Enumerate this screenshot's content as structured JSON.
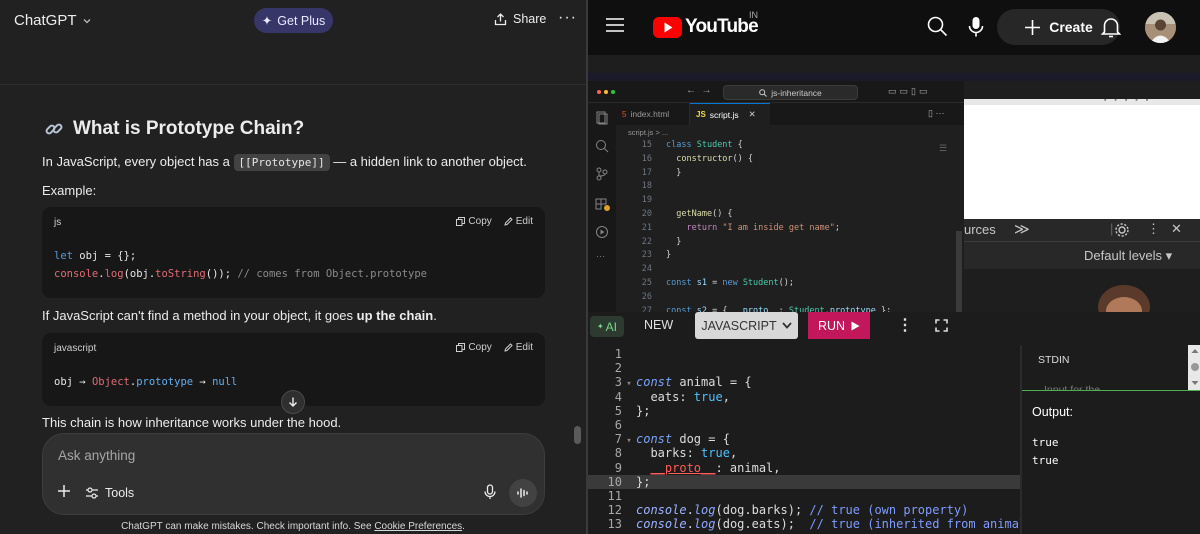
{
  "chatgpt": {
    "title": "ChatGPT",
    "get_plus": "Get Plus",
    "share": "Share",
    "more": "···",
    "heading_icon": "link-emoji",
    "heading": "What is Prototype Chain?",
    "p1_before": "In JavaScript, every object has a",
    "p1_code": "[[Prototype]]",
    "p1_after": "— a hidden link to another object.",
    "example": "Example:",
    "code1": {
      "lang": "js",
      "copy": "Copy",
      "edit": "Edit",
      "line1_kw": "let",
      "line1_rest": " obj = {};",
      "line2_obj": "console",
      "line2_dot": ".",
      "line2_fn": "log",
      "line2_mid": "(obj.",
      "line2_fn2": "toString",
      "line2_end": "()); ",
      "line2_comment": "// comes from Object.prototype"
    },
    "p2_before": "If JavaScript can't find a method in your object, it goes",
    "p2_bold": "up the chain",
    "p2_after": ".",
    "code2": {
      "lang": "javascript",
      "copy": "Copy",
      "edit": "Edit",
      "t1": "obj → ",
      "t2": "Object",
      "t3": ".",
      "t4": "prototype",
      "t5": " → ",
      "t6": "null"
    },
    "p3": "This chain is how inheritance works under the hood.",
    "composer_placeholder": "Ask anything",
    "tools": "Tools",
    "disclaimer": "ChatGPT can make mistakes. Check important info. See",
    "cookie_link": "Cookie Preferences",
    "disclaimer_end": "."
  },
  "youtube": {
    "logo": "YouTube",
    "country": "IN",
    "create": "Create",
    "video": {
      "search_text": "js-inheritance",
      "tab1": "index.html",
      "tab2": "script.js",
      "breadcrumb": "script.js > ...",
      "code": [
        {
          "n": "15",
          "t": [
            [
              "c-blue",
              "class"
            ],
            [
              "",
              " "
            ],
            [
              "c-cls",
              "Student"
            ],
            [
              "",
              " {"
            ]
          ]
        },
        {
          "n": "16",
          "t": [
            [
              "",
              "  "
            ],
            [
              "c-fn",
              "constructor"
            ],
            [
              "",
              "() {"
            ]
          ]
        },
        {
          "n": "17",
          "t": [
            [
              "",
              "  }"
            ]
          ]
        },
        {
          "n": "18",
          "t": [
            [
              "",
              ""
            ]
          ]
        },
        {
          "n": "19",
          "t": [
            [
              "",
              ""
            ]
          ]
        },
        {
          "n": "20",
          "t": [
            [
              "",
              "  "
            ],
            [
              "c-fn",
              "getName"
            ],
            [
              "",
              "() {"
            ]
          ]
        },
        {
          "n": "21",
          "t": [
            [
              "",
              "    "
            ],
            [
              "c-kw",
              "return"
            ],
            [
              "",
              " "
            ],
            [
              "c-str",
              "\"I am inside get name\""
            ],
            [
              "",
              ";"
            ]
          ]
        },
        {
          "n": "22",
          "t": [
            [
              "",
              "  }"
            ]
          ]
        },
        {
          "n": "23",
          "t": [
            [
              "",
              "}"
            ]
          ]
        },
        {
          "n": "24",
          "t": [
            [
              "",
              ""
            ]
          ]
        },
        {
          "n": "25",
          "t": [
            [
              "c-blue",
              "const"
            ],
            [
              "",
              " "
            ],
            [
              "c-var",
              "s1"
            ],
            [
              "",
              " = "
            ],
            [
              "c-blue",
              "new"
            ],
            [
              "",
              " "
            ],
            [
              "c-cls",
              "Student"
            ],
            [
              "",
              "();"
            ]
          ]
        },
        {
          "n": "26",
          "t": [
            [
              "",
              ""
            ]
          ]
        },
        {
          "n": "27",
          "t": [
            [
              "c-blue",
              "const"
            ],
            [
              "",
              " "
            ],
            [
              "c-var",
              "s2"
            ],
            [
              "",
              " = { "
            ],
            [
              "c-var",
              "__proto__"
            ],
            [
              "",
              ": "
            ],
            [
              "c-cls",
              "Student"
            ],
            [
              "",
              "."
            ],
            [
              "c-var",
              "prototype"
            ],
            [
              "",
              " };"
            ]
          ]
        }
      ],
      "devtools_sources": "urces",
      "devtools_arrows": "≫",
      "devtools_levels": "Default levels ▾"
    }
  },
  "compiler": {
    "ai": "AI",
    "new": "NEW",
    "language": "JAVASCRIPT",
    "run": "RUN",
    "stdin": "STDIN",
    "stdin_placeholder": "Input for the",
    "output_label": "Output:",
    "output": [
      "true",
      "true"
    ],
    "active_line": "10",
    "lines": [
      {
        "n": "1",
        "fold": "",
        "t": []
      },
      {
        "n": "2",
        "fold": "",
        "t": []
      },
      {
        "n": "3",
        "fold": "▾",
        "t": [
          [
            "j-kw",
            "const"
          ],
          [
            "",
            " animal = {"
          ]
        ]
      },
      {
        "n": "4",
        "fold": "",
        "t": [
          [
            "",
            "  eats: "
          ],
          [
            "j-val",
            "true"
          ],
          [
            "",
            ","
          ]
        ]
      },
      {
        "n": "5",
        "fold": "",
        "t": [
          [
            "",
            "};"
          ]
        ]
      },
      {
        "n": "6",
        "fold": "",
        "t": []
      },
      {
        "n": "7",
        "fold": "▾",
        "t": [
          [
            "j-kw",
            "const"
          ],
          [
            "",
            " dog = {"
          ]
        ]
      },
      {
        "n": "8",
        "fold": "",
        "t": [
          [
            "",
            "  barks: "
          ],
          [
            "j-val",
            "true"
          ],
          [
            "",
            ","
          ]
        ]
      },
      {
        "n": "9",
        "fold": "",
        "t": [
          [
            "",
            "  "
          ],
          [
            "j-proto",
            "__proto__"
          ],
          [
            "",
            ": animal,"
          ]
        ]
      },
      {
        "n": "10",
        "fold": "",
        "t": [
          [
            "",
            "};"
          ]
        ]
      },
      {
        "n": "11",
        "fold": "",
        "t": []
      },
      {
        "n": "12",
        "fold": "",
        "t": [
          [
            "j-obj",
            "console"
          ],
          [
            "",
            "."
          ],
          [
            "j-fn",
            "log"
          ],
          [
            "",
            "(dog.barks); "
          ],
          [
            "j-cm",
            "// true (own property)"
          ]
        ]
      },
      {
        "n": "13",
        "fold": "",
        "t": [
          [
            "j-obj",
            "console"
          ],
          [
            "",
            "."
          ],
          [
            "j-fn",
            "log"
          ],
          [
            "",
            "(dog.eats);  "
          ],
          [
            "j-cm",
            "// true (inherited from animal)"
          ]
        ]
      }
    ]
  }
}
